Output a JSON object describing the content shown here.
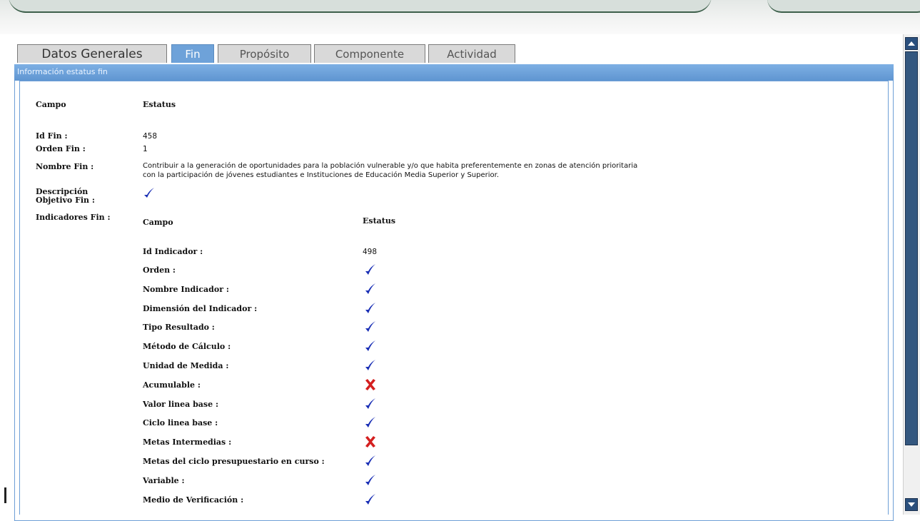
{
  "tabs": [
    {
      "label": "Datos Generales",
      "active": false
    },
    {
      "label": "Fin",
      "active": true
    },
    {
      "label": "Propósito",
      "active": false
    },
    {
      "label": "Componente",
      "active": false
    },
    {
      "label": "Actividad",
      "active": false
    }
  ],
  "panel": {
    "header": "Información estatus fin",
    "col_campo": "Campo",
    "col_estatus": "Estatus",
    "fields": {
      "id_fin_label": "Id Fin :",
      "id_fin_value": "458",
      "orden_fin_label": "Orden Fin :",
      "orden_fin_value": "1",
      "nombre_fin_label": "Nombre Fin :",
      "nombre_fin_line1": "Contribuir a la generación de oportunidades para la población vulnerable y/o que habita preferentemente en zonas de atención prioritaria",
      "nombre_fin_line2": "con la participación de jóvenes estudiantes e Instituciones de Educación Media Superior y Superior.",
      "descripcion_label_1": "Descripción",
      "descripcion_label_2": "Objetivo Fin :",
      "descripcion_status": "check",
      "indicadores_label": "Indicadores Fin :"
    },
    "indicadores": {
      "col_campo": "Campo",
      "col_estatus": "Estatus",
      "id_label": "Id Indicador :",
      "id_value": "498",
      "rows": [
        {
          "label": "Orden :",
          "status": "check"
        },
        {
          "label": "Nombre Indicador :",
          "status": "check"
        },
        {
          "label": "Dimensión del Indicador :",
          "status": "check"
        },
        {
          "label": "Tipo Resultado :",
          "status": "check"
        },
        {
          "label": "Método de Cálculo :",
          "status": "check"
        },
        {
          "label": "Unidad de Medida :",
          "status": "check"
        },
        {
          "label": "Acumulable :",
          "status": "cross"
        },
        {
          "label": "Valor linea base :",
          "status": "check"
        },
        {
          "label": "Ciclo linea base :",
          "status": "check"
        },
        {
          "label": "Metas Intermedias :",
          "status": "cross"
        },
        {
          "label": "Metas del ciclo presupuestario en curso :",
          "status": "check"
        },
        {
          "label": "Variable :",
          "status": "check"
        },
        {
          "label": "Medio de Verificación :",
          "status": "check"
        }
      ]
    }
  },
  "colors": {
    "check": "#1a2fb5",
    "cross": "#d41f1f",
    "tab_active": "#6ea2d9",
    "panel_header": "#6ea2d9"
  }
}
